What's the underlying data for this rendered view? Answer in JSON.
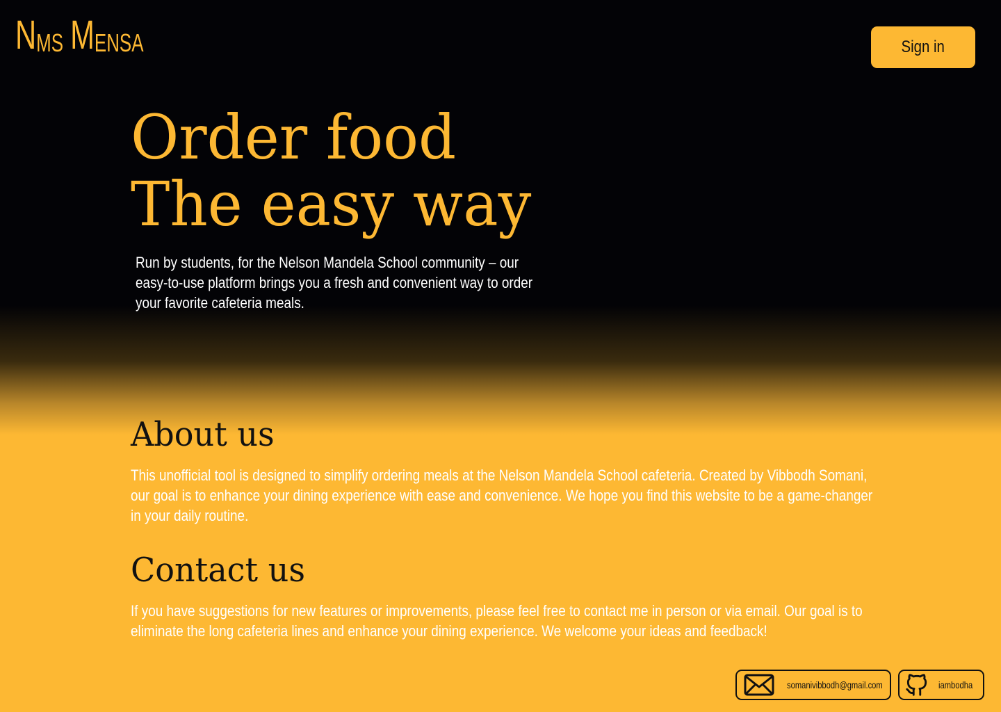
{
  "header": {
    "logo": {
      "w1_initial": "N",
      "w1_rest": "MS",
      "w2_initial": "M",
      "w2_rest": "ENSA"
    },
    "signin_label": "Sign in"
  },
  "hero": {
    "title_line1": "Order food",
    "title_line2": "The easy way",
    "description": "Run by students, for the Nelson Mandela School community – our easy-to-use platform brings you a fresh and convenient way to order your favorite cafeteria meals."
  },
  "about": {
    "title": "About us",
    "text": "This unofficial tool is designed to simplify ordering meals at the Nelson Mandela School cafeteria. Created by Vibbodh Somani, our goal is to enhance your dining experience with ease and convenience. We hope you find this website to be a game-changer in your daily routine."
  },
  "contact": {
    "title": "Contact us",
    "text": "If you have suggestions for new features or improvements, please feel free to contact me in person or via email. Our goal is to eliminate the long cafeteria lines and enhance your dining experience. We welcome your ideas and feedback!"
  },
  "footer": {
    "email": {
      "icon": "mail-icon",
      "label": "somanivibbodh@gmail.com"
    },
    "github": {
      "icon": "github-icon",
      "label": "iambodha"
    }
  },
  "colors": {
    "accent": "#fdb833",
    "dark": "#030306",
    "text_dark": "#111111",
    "text_light": "#ffffff"
  }
}
